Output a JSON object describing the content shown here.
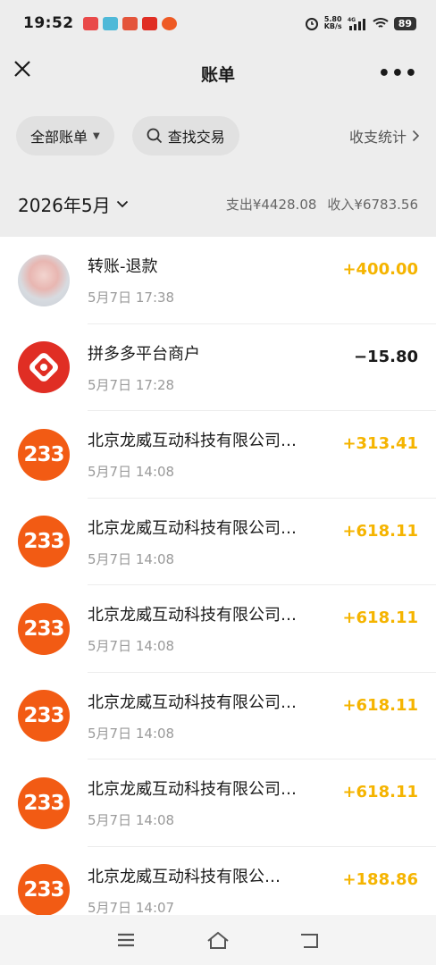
{
  "status": {
    "time": "19:52",
    "net_speed_value": "5.80",
    "net_speed_unit": "KB/s",
    "signal_label": "4G",
    "battery": "89"
  },
  "header": {
    "title": "账单"
  },
  "filters": {
    "all_bills_label": "全部账单",
    "search_label": "查找交易",
    "stats_label": "收支统计"
  },
  "month": {
    "label": "2026年5月",
    "expense": "支出¥4428.08",
    "income": "收入¥6783.56"
  },
  "transactions": [
    {
      "title": "转账-退款",
      "time": "5月7日 17:38",
      "amount": "+400.00",
      "avatar": "user-photo",
      "positive": true
    },
    {
      "title": "拼多多平台商户",
      "time": "5月7日 17:28",
      "amount": "−15.80",
      "avatar": "pinduoduo-logo",
      "positive": false
    },
    {
      "title": "北京龙威互动科技有限公司…",
      "time": "5月7日 14:08",
      "amount": "+313.41",
      "avatar": "233-logo",
      "avatar_text": "233",
      "positive": true
    },
    {
      "title": "北京龙威互动科技有限公司…",
      "time": "5月7日 14:08",
      "amount": "+618.11",
      "avatar": "233-logo",
      "avatar_text": "233",
      "positive": true
    },
    {
      "title": "北京龙威互动科技有限公司…",
      "time": "5月7日 14:08",
      "amount": "+618.11",
      "avatar": "233-logo",
      "avatar_text": "233",
      "positive": true
    },
    {
      "title": "北京龙威互动科技有限公司…",
      "time": "5月7日 14:08",
      "amount": "+618.11",
      "avatar": "233-logo",
      "avatar_text": "233",
      "positive": true
    },
    {
      "title": "北京龙威互动科技有限公司…",
      "time": "5月7日 14:08",
      "amount": "+618.11",
      "avatar": "233-logo",
      "avatar_text": "233",
      "positive": true
    },
    {
      "title": "北京龙威互动科技有限公…",
      "time": "5月7日 14:07",
      "amount": "+188.86",
      "avatar": "233-logo",
      "avatar_text": "233",
      "positive": true
    }
  ],
  "colors": {
    "income": "#f5b400",
    "pdd_red": "#e02e24",
    "avatar_233": "#f25b14"
  }
}
